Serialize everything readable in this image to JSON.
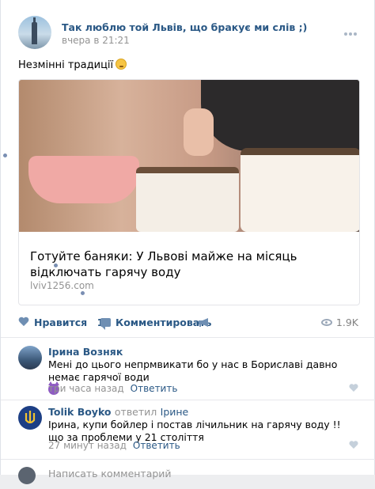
{
  "post": {
    "group_name": "Так люблю той Львів, що бракує ми слів ;)",
    "time": "вчера в 21:21",
    "text": "Незмінні традиції",
    "link": {
      "title": "Готуйте баняки: У Львові майже на місяць відключать гарячу воду",
      "source": "lviv1256.com"
    },
    "actions": {
      "like_label": "Нравится",
      "like_count": "18",
      "comment_label": "Комментировать",
      "views": "1.9K"
    }
  },
  "comments": [
    {
      "author": "Ірина Возняк",
      "text": "Мені до цього непрмвикати бо у нас в Бориславі давно немає гарячої води",
      "time": "три часа назад",
      "reply_label": "Ответить"
    },
    {
      "author": "Tolik Boyko",
      "replied_word": "ответил",
      "reply_to": "Ірине",
      "text": "Ірина, купи бойлер і постав лічильник на гарячу воду !! що за проблеми у 21 століття",
      "time": "27 минут назад",
      "reply_label": "Ответить"
    }
  ],
  "write_comment": {
    "placeholder": "Написать комментарий"
  },
  "colors": {
    "link": "#2a5885",
    "meta": "#939393",
    "icon": "#6f8fb3"
  }
}
